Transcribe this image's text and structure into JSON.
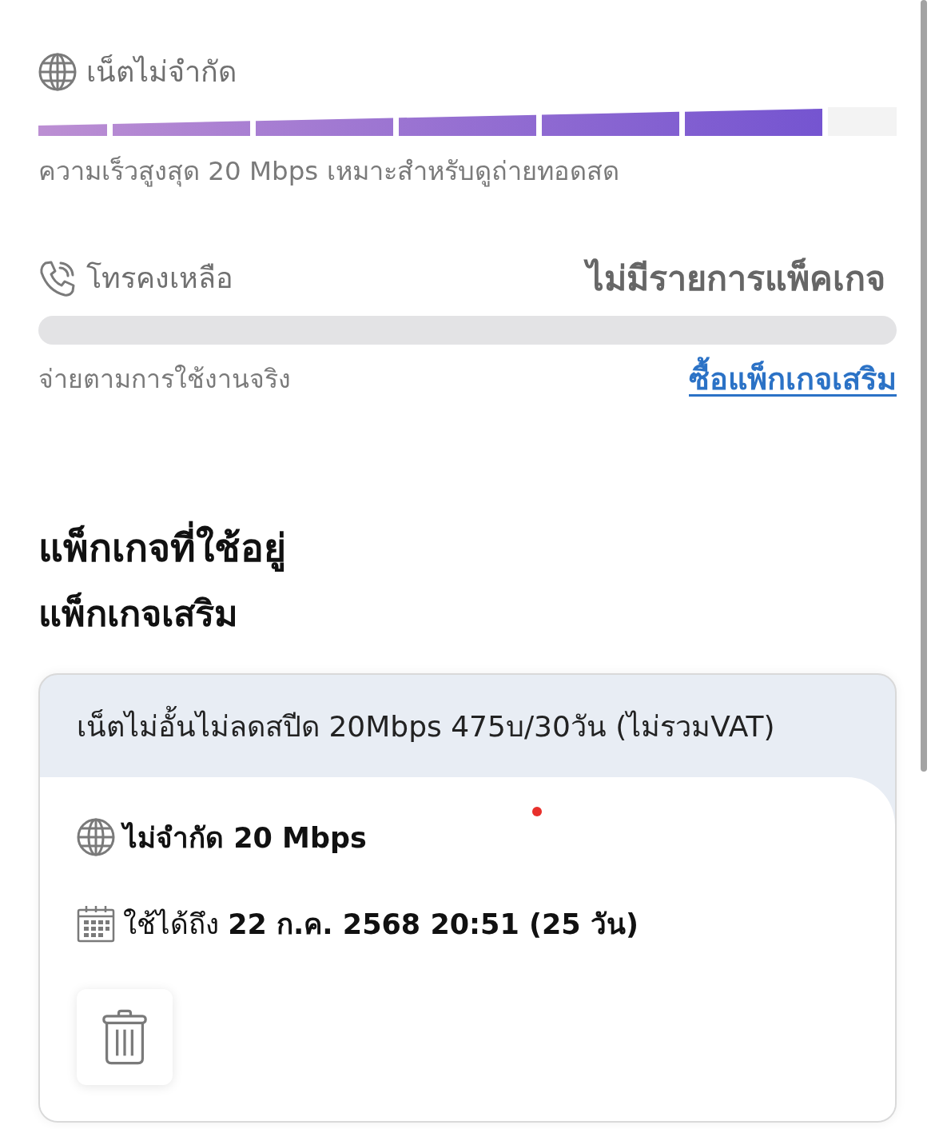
{
  "data_section": {
    "title": "เน็ตไม่จำกัด",
    "speed_meter": {
      "segments": [
        {
          "filled": true
        },
        {
          "filled": true
        },
        {
          "filled": true
        },
        {
          "filled": true
        },
        {
          "filled": true
        },
        {
          "filled": true
        },
        {
          "filled": false
        }
      ]
    },
    "caption": "ความเร็วสูงสุด 20 Mbps เหมาะสำหรับดูถ่ายทอดสด"
  },
  "call_section": {
    "title": "โทรคงเหลือ",
    "status": "ไม่มีรายการแพ็คเกจ",
    "caption": "จ่ายตามการใช้งานจริง",
    "buy_link": "ซื้อแพ็กเกจเสริม"
  },
  "active_packages": {
    "heading": "แพ็กเกจที่ใช้อยู่",
    "subheading": "แพ็กเกจเสริม",
    "packages": [
      {
        "name": "เน็ตไม่อั้นไม่ลดสปีด 20Mbps 475บ/30วัน (ไม่รวมVAT)",
        "features": [
          {
            "kind": "data",
            "text": "ไม่จำกัด 20 Mbps"
          },
          {
            "kind": "validity",
            "text": "ใช้ได้ถึง **22 ก.ค. 2568 20:51 (25 วัน)**"
          }
        ]
      }
    ]
  }
}
